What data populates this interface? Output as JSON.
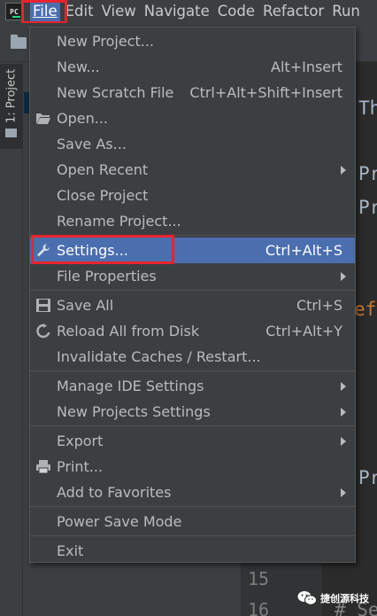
{
  "menubar": {
    "items": [
      {
        "label": "File",
        "mnemonic_index": 0
      },
      {
        "label": "Edit"
      },
      {
        "label": "View"
      },
      {
        "label": "Navigate"
      },
      {
        "label": "Code"
      },
      {
        "label": "Refactor"
      },
      {
        "label": "Run"
      }
    ],
    "active": "File",
    "logo_text": "PC"
  },
  "sidebar": {
    "project_tab_label": "1: Project"
  },
  "file_menu": {
    "items": [
      {
        "label": "New Project...",
        "shortcut": ""
      },
      {
        "label": "New...",
        "shortcut": "Alt+Insert"
      },
      {
        "label": "New Scratch File",
        "shortcut": "Ctrl+Alt+Shift+Insert"
      },
      {
        "label": "Open...",
        "shortcut": "",
        "icon": "folder-open-icon"
      },
      {
        "label": "Save As...",
        "shortcut": ""
      },
      {
        "label": "Open Recent",
        "shortcut": "",
        "submenu": true
      },
      {
        "label": "Close Project",
        "shortcut": ""
      },
      {
        "label": "Rename Project...",
        "shortcut": ""
      },
      {
        "label": "Settings...",
        "shortcut": "Ctrl+Alt+S",
        "icon": "wrench-icon",
        "selected": true
      },
      {
        "label": "File Properties",
        "shortcut": "",
        "submenu": true
      },
      {
        "label": "Save All",
        "shortcut": "Ctrl+S",
        "icon": "floppy-disk-icon"
      },
      {
        "label": "Reload All from Disk",
        "shortcut": "Ctrl+Alt+Y",
        "icon": "reload-icon"
      },
      {
        "label": "Invalidate Caches / Restart...",
        "shortcut": ""
      },
      {
        "label": "Manage IDE Settings",
        "shortcut": "",
        "submenu": true
      },
      {
        "label": "New Projects Settings",
        "shortcut": "",
        "submenu": true
      },
      {
        "label": "Export",
        "shortcut": "",
        "submenu": true
      },
      {
        "label": "Print...",
        "shortcut": "",
        "icon": "printer-icon"
      },
      {
        "label": "Add to Favorites",
        "shortcut": "",
        "submenu": true
      },
      {
        "label": "Power Save Mode",
        "shortcut": ""
      },
      {
        "label": "Exit",
        "shortcut": ""
      }
    ]
  },
  "editor": {
    "line_numbers": [
      "15",
      "16"
    ],
    "fragments": [
      "Th",
      "Pr",
      "Pr",
      "ef",
      "Pr",
      "# Se"
    ]
  },
  "watermark": {
    "text": "捷创源科技"
  },
  "colors": {
    "selection": "#4b6eaf",
    "highlight_box": "#e8232f",
    "menu_bg": "#3c3f41",
    "editor_bg": "#2b2b2b",
    "keyword": "#cc7832"
  }
}
